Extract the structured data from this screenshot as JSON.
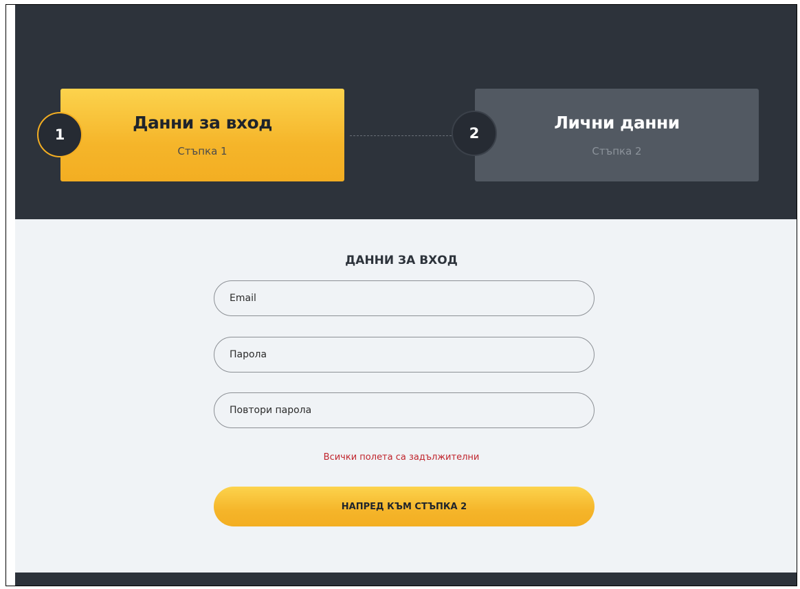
{
  "wizard": {
    "steps": [
      {
        "number": "1",
        "title": "Данни за вход",
        "subtitle": "Стъпка 1",
        "state": "active"
      },
      {
        "number": "2",
        "title": "Лични данни",
        "subtitle": "Стъпка 2",
        "state": "inactive"
      }
    ]
  },
  "form": {
    "title": "ДАННИ ЗА ВХОД",
    "fields": {
      "email": {
        "placeholder": "Email",
        "value": ""
      },
      "password": {
        "placeholder": "Парола",
        "value": ""
      },
      "repeat_password": {
        "placeholder": "Повтори парола",
        "value": ""
      }
    },
    "error": "Всички полета са задължителни",
    "submit_label": "НАПРЕД КЪМ СТЪПКА 2"
  },
  "colors": {
    "header_bg": "#2d333b",
    "accent": "#f5b52a",
    "inactive_step": "#525962",
    "error": "#c0242c",
    "form_bg": "#f0f3f6"
  }
}
